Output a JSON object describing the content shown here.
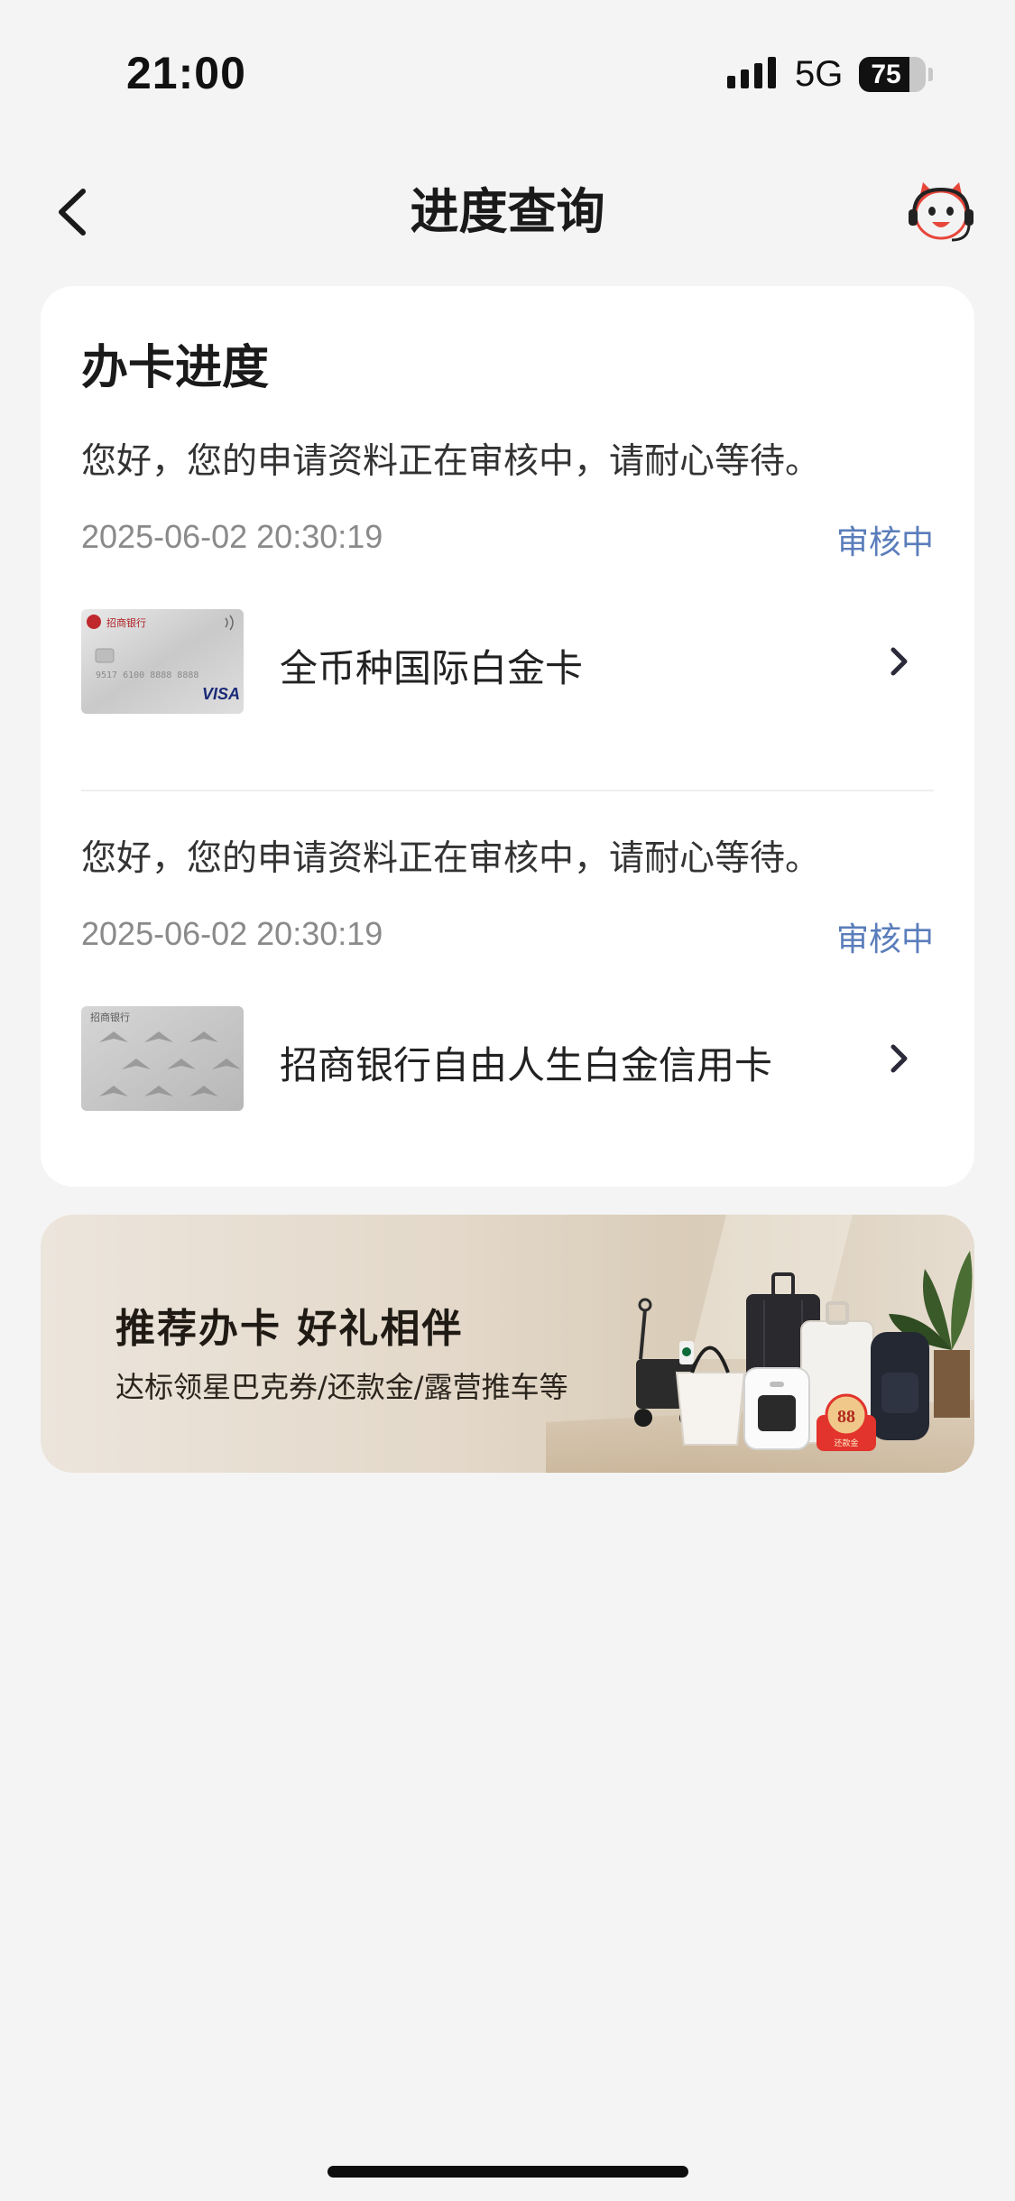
{
  "status_bar": {
    "time": "21:00",
    "network": "5G",
    "battery": "75",
    "battery_level": 0.75
  },
  "nav": {
    "title": "进度查询",
    "back_icon": "chevron-left-icon",
    "service_icon": "customer-service-mascot-icon"
  },
  "progress_card": {
    "title": "办卡进度",
    "records": [
      {
        "message": "您好，您的申请资料正在审核中，请耐心等待。",
        "time": "2025-06-02 20:30:19",
        "status": "审核中",
        "card_name": "全币种国际白金卡",
        "card_thumb_text": "招商银行",
        "card_thumb_brand": "VISA",
        "card_thumb_number": "9517 6100 8888 8888"
      },
      {
        "message": "您好，您的申请资料正在审核中，请耐心等待。",
        "time": "2025-06-02 20:30:19",
        "status": "审核中",
        "card_name": "招商银行自由人生白金信用卡",
        "card_thumb_text": "招商银行"
      }
    ]
  },
  "promo": {
    "title": "推荐办卡 好礼相伴",
    "subtitle": "达标领星巴克券/还款金/露营推车等",
    "badge_amount": "88",
    "badge_label": "还款金"
  },
  "colors": {
    "background": "#f4f4f4",
    "card": "#ffffff",
    "status_blue": "#5a7dbb",
    "muted_text": "#8a8a8a"
  }
}
